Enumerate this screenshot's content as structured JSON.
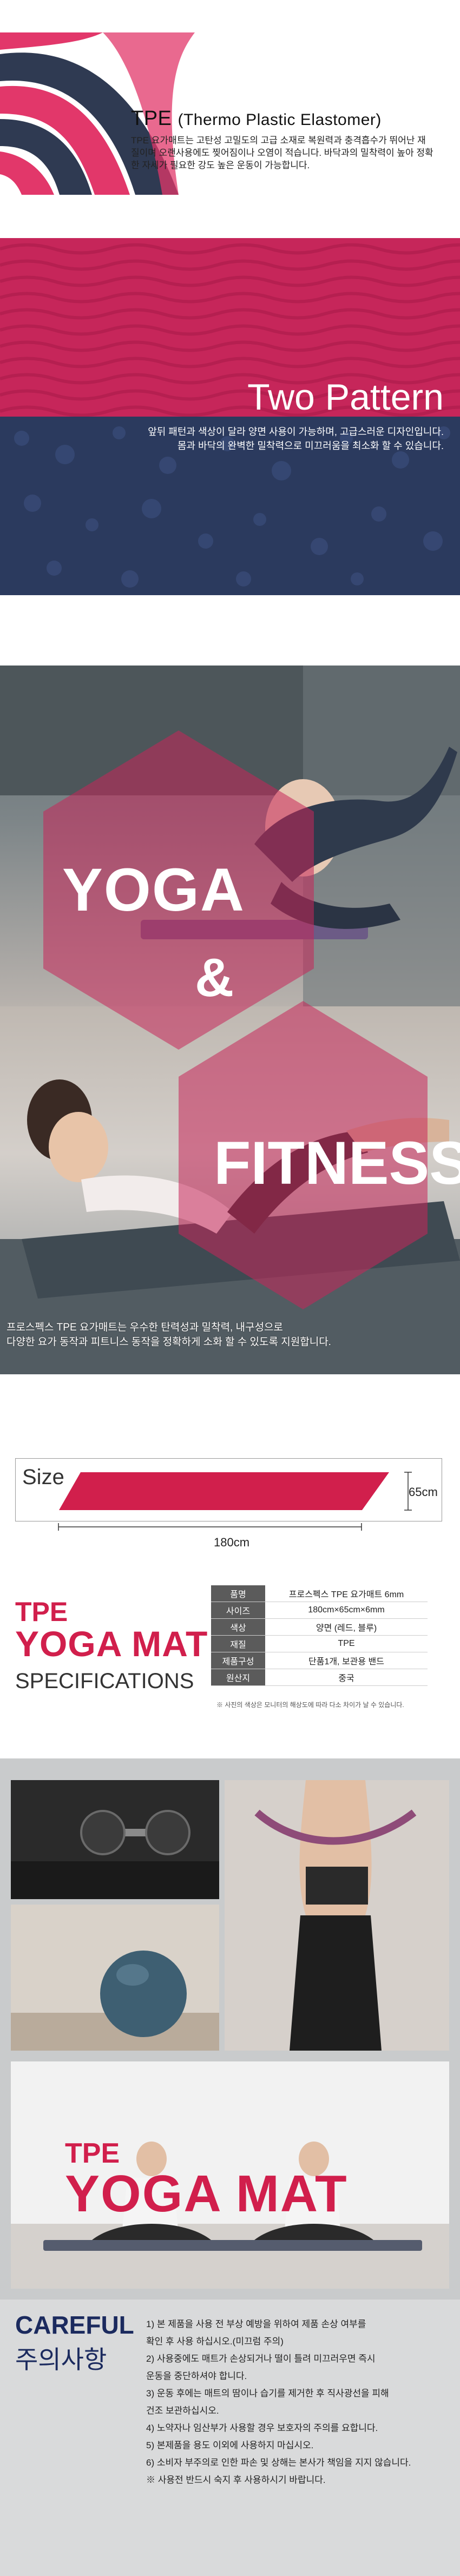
{
  "intro": {
    "title": "TPE",
    "title_sub": "(Thermo Plastic Elastomer)",
    "desc": "TPE 요가매트는 고탄성 고밀도의 고급 소재로 복원력과 충격흡수가 뛰어난 재질이며 오랜사용에도 찢어짐이나 오염이 적습니다. 바닥과의 밀착력이 높아 정확한 자세가 필요한 강도 높은 운동이 가능합니다."
  },
  "pattern": {
    "title": "Two Pattern",
    "desc_line1": "앞뒤 패턴과 색상이 달라 양면 사용이 가능하며, 고급스러운 디자인입니다.",
    "desc_line2": "몸과 바닥의 완벽한 밀착력으로 미끄러움을 최소화 할 수 있습니다.",
    "colors": {
      "top": "#c6265a",
      "bottom": "#2b3a5e"
    }
  },
  "fitness": {
    "yoga": "YOGA",
    "amp": "&",
    "fitness": "FITNESS",
    "desc_line1": "프로스펙스 TPE 요가매트는 우수한 탄력성과 밀착력, 내구성으로",
    "desc_line2": "다양한 요가 동작과 피트니스 동작을 정확하게 소화 할 수 있도록 지원합니다."
  },
  "size": {
    "label": "Size",
    "width": "180cm",
    "height": "65cm"
  },
  "specs": {
    "tpe": "TPE",
    "yoga_mat": "YOGA MAT",
    "specifications": "SPECIFICATIONS",
    "rows": [
      {
        "k": "품명",
        "v": "프로스펙스 TPE 요가매트 6mm"
      },
      {
        "k": "사이즈",
        "v": "180cm×65cm×6mm"
      },
      {
        "k": "색상",
        "v": "양면 (레드, 블루)"
      },
      {
        "k": "재질",
        "v": "TPE"
      },
      {
        "k": "제품구성",
        "v": "단품1개, 보관용 밴드"
      },
      {
        "k": "원산지",
        "v": "중국"
      }
    ],
    "note": "※ 사진의 색상은 모니터의 해상도에 따라 다소 차이가 날 수 있습니다."
  },
  "banner": {
    "tpe": "TPE",
    "yoga_mat": "YOGA MAT"
  },
  "careful": {
    "title_en": "CAREFUL",
    "title_ko": "주의사항",
    "items": [
      "1) 본 제품을 사용 전 부상 예방을 위하여 제품 손상 여부를",
      "    확인 후 사용 하십시오.(미끄럼 주의)",
      "2) 사용중에도 매트가 손상되거나 떨이 틀려 미끄러우면 즉시",
      "    운동을 중단하셔야 합니다.",
      "3) 운동 후에는 매트의 땀이나 습기를 제거한 후 직사광선을 피해",
      "    건조 보관하십시오.",
      "4) 노약자나 임산부가 사용할 경우 보호자의 주의를 요합니다.",
      "5) 본제품을 용도 이외에 사용하지 마십시오.",
      "6) 소비자 부주의로 인한 파손 및 상해는 본사가 책임을 지지 않습니다.",
      "※ 사용전 반드시 숙지 후 사용하시기 바랍니다."
    ]
  }
}
